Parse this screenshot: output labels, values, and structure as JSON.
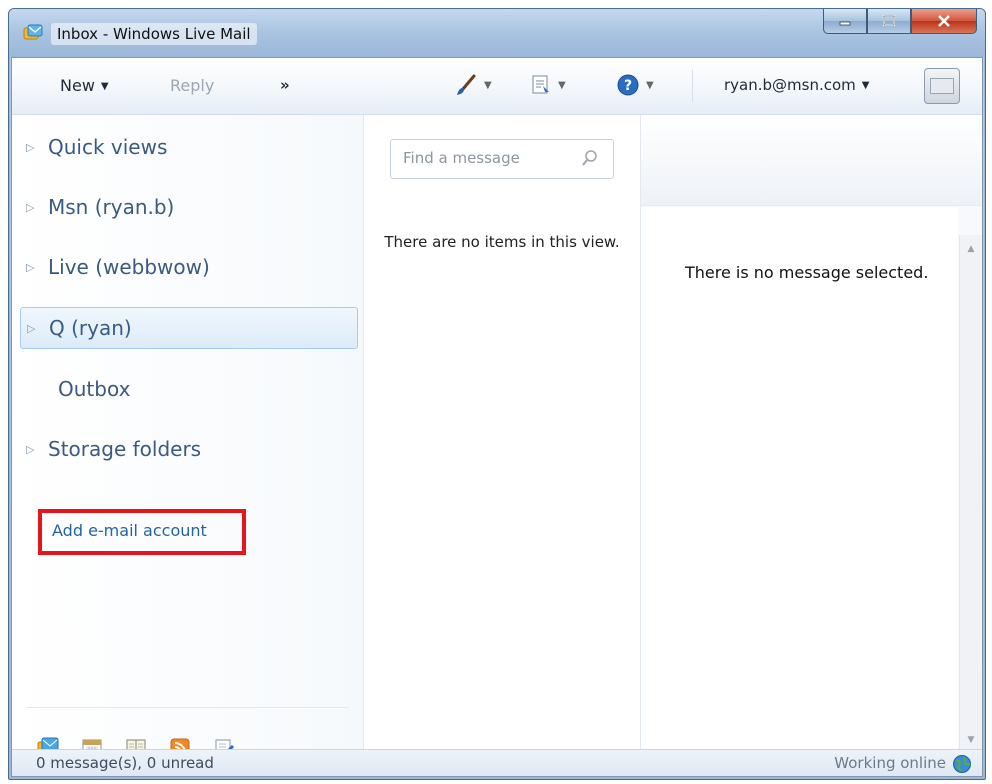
{
  "window": {
    "title": "Inbox - Windows Live Mail",
    "controls": [
      "minimize",
      "maximize",
      "close"
    ]
  },
  "toolbar": {
    "new_label": "New",
    "reply_label": "Reply",
    "more_label": "»",
    "icons": [
      "paintbrush-icon",
      "layout-icon",
      "help-icon"
    ],
    "account_label": "ryan.b@msn.com"
  },
  "sidebar": {
    "items": [
      {
        "label": "Quick views",
        "expandable": true
      },
      {
        "label": "Msn (ryan.b)",
        "expandable": true
      },
      {
        "label": "Live (webbwow)",
        "expandable": true
      },
      {
        "label": "Q (ryan)",
        "expandable": true,
        "selected": true
      },
      {
        "label": "Outbox",
        "expandable": false
      },
      {
        "label": "Storage folders",
        "expandable": true
      }
    ],
    "add_account_label": "Add e-mail account",
    "highlight_color": "#e8141b",
    "bottom_icons": [
      "mail-icon",
      "calendar-icon",
      "contacts-icon",
      "feeds-icon",
      "newsgroups-icon"
    ]
  },
  "message_list": {
    "search_placeholder": "Find a message",
    "empty_text": "There are no items in this view."
  },
  "reading_pane": {
    "empty_text": "There is no message selected."
  },
  "status": {
    "left": "0 message(s), 0 unread",
    "right": "Working online"
  }
}
